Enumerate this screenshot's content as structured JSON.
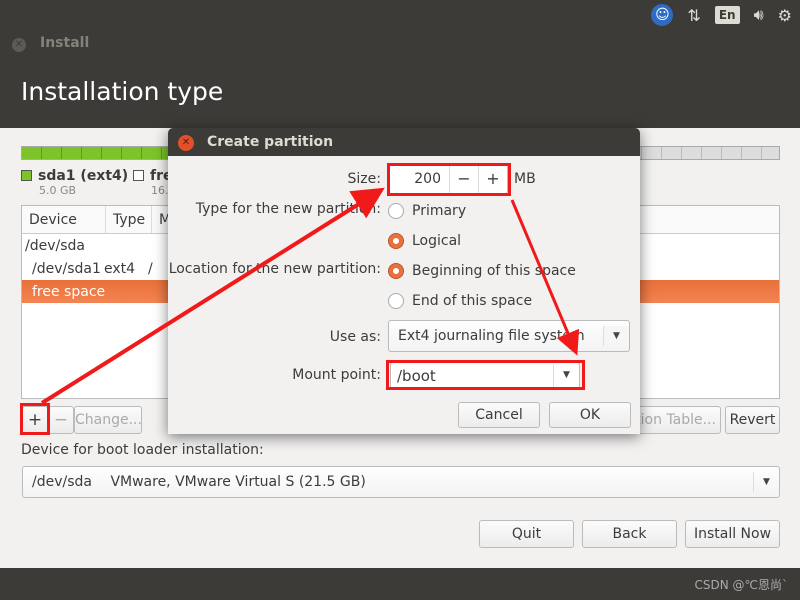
{
  "topbar": {
    "icons": [
      "accessibility-icon",
      "network-icon",
      "keyboard-layout-icon",
      "volume-icon",
      "power-gear-icon"
    ],
    "keyboard_layout": "En"
  },
  "window": {
    "title": "Install",
    "page_title": "Installation type"
  },
  "partitions": {
    "legend": [
      {
        "name": "sda1 (ext4)",
        "size": "5.0 GB",
        "color": "#7cc42a"
      },
      {
        "name": "fre",
        "size": "16.",
        "color": "#ffffff"
      }
    ],
    "columns": [
      "Device",
      "Type",
      "M"
    ],
    "rows": [
      {
        "device": "/dev/sda",
        "type": "",
        "mount": ""
      },
      {
        "device": "/dev/sda1",
        "type": "ext4",
        "mount": "/"
      },
      {
        "device": "free space",
        "type": "",
        "mount": "",
        "selected": true
      }
    ]
  },
  "toolbar": {
    "add": "+",
    "remove": "−",
    "change": "Change...",
    "new_table": "tion Table...",
    "revert": "Revert"
  },
  "bootloader": {
    "label": "Device for boot loader installation:",
    "device": "/dev/sda",
    "description": "VMware, VMware Virtual S (21.5 GB)"
  },
  "buttons": {
    "quit": "Quit",
    "back": "Back",
    "install": "Install Now"
  },
  "dialog": {
    "title": "Create partition",
    "size_label": "Size:",
    "size_value": "200",
    "size_unit": "MB",
    "minus": "−",
    "plus": "+",
    "type_label": "Type for the new partition:",
    "type_options": [
      "Primary",
      "Logical"
    ],
    "type_selected": "Logical",
    "location_label": "Location for the new partition:",
    "location_options": [
      "Beginning of this space",
      "End of this space"
    ],
    "location_selected": "Beginning of this space",
    "use_as_label": "Use as:",
    "use_as_value": "Ext4 journaling file system",
    "mount_label": "Mount point:",
    "mount_value": "/boot",
    "cancel": "Cancel",
    "ok": "OK"
  },
  "annotation_color": "#f01a1a",
  "watermark": "CSDN @℃恩尚`"
}
